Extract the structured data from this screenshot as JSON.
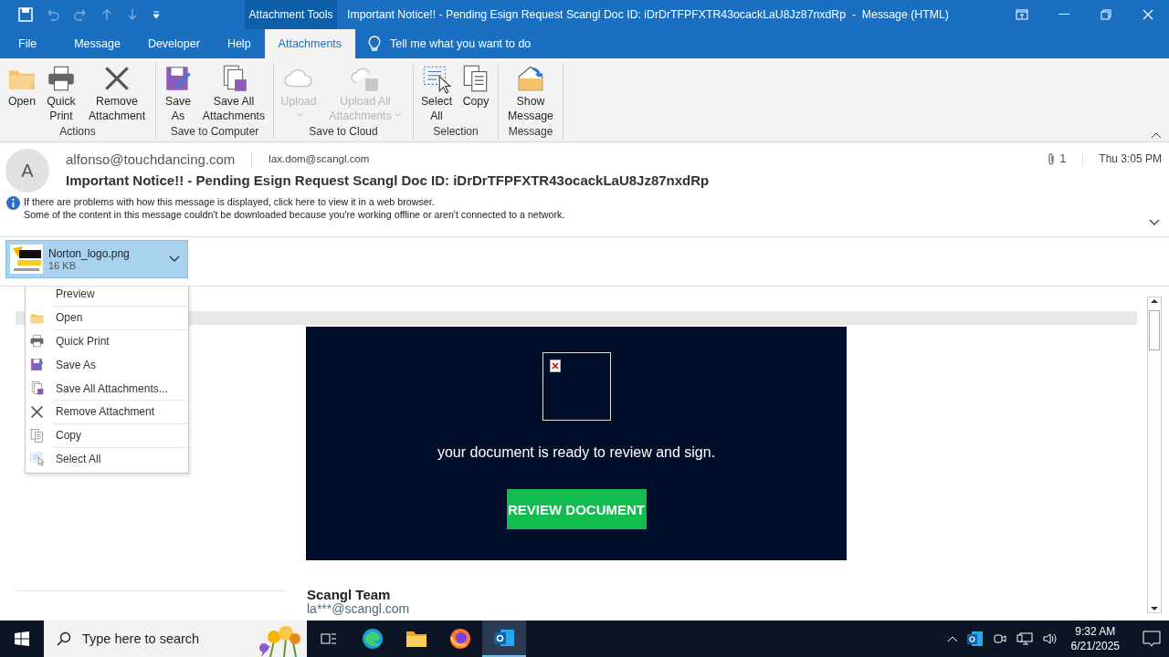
{
  "window": {
    "context_label": "Attachment Tools",
    "title": "Important Notice!! - Pending Esign Request Scangl Doc ID: iDrDrTFPFXTR43ocackLaU8Jz87nxdRp  -  Message (HTML)"
  },
  "tabs": [
    {
      "label": "File",
      "selected": false
    },
    {
      "label": "Message",
      "selected": false
    },
    {
      "label": "Developer",
      "selected": false
    },
    {
      "label": "Help",
      "selected": false
    },
    {
      "label": "Attachments",
      "selected": true
    }
  ],
  "tell_me": {
    "placeholder": "Tell me what you want to do"
  },
  "ribbon_groups": [
    {
      "label": "Actions",
      "buttons": [
        {
          "label": "Open",
          "kind": "folder",
          "disabled": false,
          "has_menu": false
        },
        {
          "label": "Quick Print",
          "kind": "printer",
          "disabled": false,
          "has_menu": false
        },
        {
          "label": "Remove Attachment",
          "kind": "remove",
          "disabled": false,
          "has_menu": false
        }
      ]
    },
    {
      "label": "Save to Computer",
      "buttons": [
        {
          "label": "Save As",
          "kind": "save",
          "disabled": false,
          "has_menu": false
        },
        {
          "label": "Save All Attachments",
          "kind": "save-all",
          "disabled": false,
          "has_menu": false
        }
      ]
    },
    {
      "label": "Save to Cloud",
      "buttons": [
        {
          "label": "Upload",
          "kind": "cloud",
          "disabled": true,
          "has_menu": true
        },
        {
          "label": "Upload All Attachments",
          "kind": "cloud-save",
          "disabled": true,
          "has_menu": true
        }
      ]
    },
    {
      "label": "Selection",
      "buttons": [
        {
          "label": "Select All",
          "kind": "select",
          "disabled": false,
          "has_menu": false
        },
        {
          "label": "Copy",
          "kind": "copy",
          "disabled": false,
          "has_menu": false
        }
      ]
    },
    {
      "label": "Message",
      "buttons": [
        {
          "label": "Show Message",
          "kind": "message",
          "disabled": false,
          "has_menu": false
        }
      ]
    }
  ],
  "message": {
    "sender_initial": "A",
    "from": "alfonso@touchdancing.com",
    "to": "lax.dom@scangl.com",
    "attachment_count": "1",
    "date": "Thu 3:05 PM",
    "subject": "Important Notice!! - Pending Esign Request Scangl Doc ID: iDrDrTFPFXTR43ocackLaU8Jz87nxdRp",
    "notices": [
      "If there are problems with how this message is displayed, click here to view it in a web browser.",
      "Some of the content in this message couldn't be downloaded because you're working offline or aren't connected to a network."
    ]
  },
  "attachment": {
    "name": "Norton_logo.png",
    "size": "16 KB",
    "selected": true
  },
  "context_menu": [
    {
      "label": "Preview",
      "kind": "none"
    },
    {
      "label": "Open",
      "kind": "folder"
    },
    {
      "label": "Quick Print",
      "kind": "printer"
    },
    {
      "label": "Save As",
      "kind": "save"
    },
    {
      "label": "Save All Attachments...",
      "kind": "save-all"
    },
    {
      "label": "Remove Attachment",
      "kind": "remove"
    },
    {
      "label": "Copy",
      "kind": "copy"
    },
    {
      "label": "Select All",
      "kind": "select"
    }
  ],
  "email_body": {
    "message": "your document is ready to review and sign.",
    "button": "REVIEW DOCUMENT",
    "signature_name": "Scangl Team",
    "signature_email": "la***@scangl.com"
  },
  "taskbar": {
    "search_placeholder": "Type here to search",
    "time": "9:32 AM",
    "date": "6/21/2025"
  }
}
